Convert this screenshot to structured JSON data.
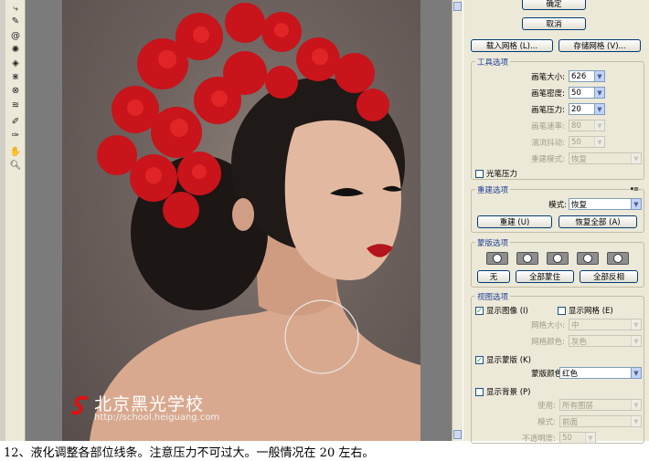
{
  "tools": {
    "icons": [
      "warp-icon",
      "reconstruct-icon",
      "twirl-icon",
      "pucker-icon",
      "bloat-icon",
      "push-left-icon",
      "mirror-icon",
      "turbulence-icon",
      "freeze-mask-icon",
      "thaw-mask-icon",
      "hand-icon",
      "zoom-icon"
    ]
  },
  "watermark": {
    "title": "北京黑光学校",
    "url": "http://school.heiguang.com"
  },
  "panel": {
    "ok_label": "确定",
    "cancel_label": "取消",
    "load_mesh_label": "载入网格 (L)...",
    "save_mesh_label": "存储网格 (V)...",
    "tool_options": {
      "title": "工具选项",
      "brush_size_label": "画笔大小:",
      "brush_size": "626",
      "brush_density_label": "画笔密度:",
      "brush_density": "50",
      "brush_pressure_label": "画笔压力:",
      "brush_pressure": "20",
      "brush_rate_label": "画笔速率:",
      "brush_rate": "80",
      "turbulent_jitter_label": "湍流抖动:",
      "turbulent_jitter": "50",
      "reconstruct_mode_label": "重建模式:",
      "reconstruct_mode": "恢复",
      "stylus_pressure_label": "光笔压力"
    },
    "reconstruct_options": {
      "title": "重建选项",
      "mode_label": "模式:",
      "mode": "恢复",
      "reconstruct_label": "重建 (U)",
      "restore_all_label": "恢复全部 (A)"
    },
    "mask_options": {
      "title": "蒙版选项",
      "none_label": "无",
      "mask_all_label": "全部蒙住",
      "invert_all_label": "全部反相"
    },
    "view_options": {
      "title": "视图选项",
      "show_image_label": "显示图像 (I)",
      "show_mesh_label": "显示网格 (E)",
      "mesh_size_label": "网格大小:",
      "mesh_size": "中",
      "mesh_color_label": "网格颜色:",
      "mesh_color": "灰色",
      "show_mask_label": "显示蒙版 (K)",
      "mask_color_label": "蒙版颜色:",
      "mask_color": "红色",
      "show_backdrop_label": "显示背景 (P)",
      "use_label": "使用:",
      "use": "所有图层",
      "mode_label": "模式:",
      "mode": "前面",
      "opacity_label": "不透明度:",
      "opacity": "50"
    }
  },
  "caption": "12、液化调整各部位线条。注意压力不可过大。一般情况在 20 左右。"
}
